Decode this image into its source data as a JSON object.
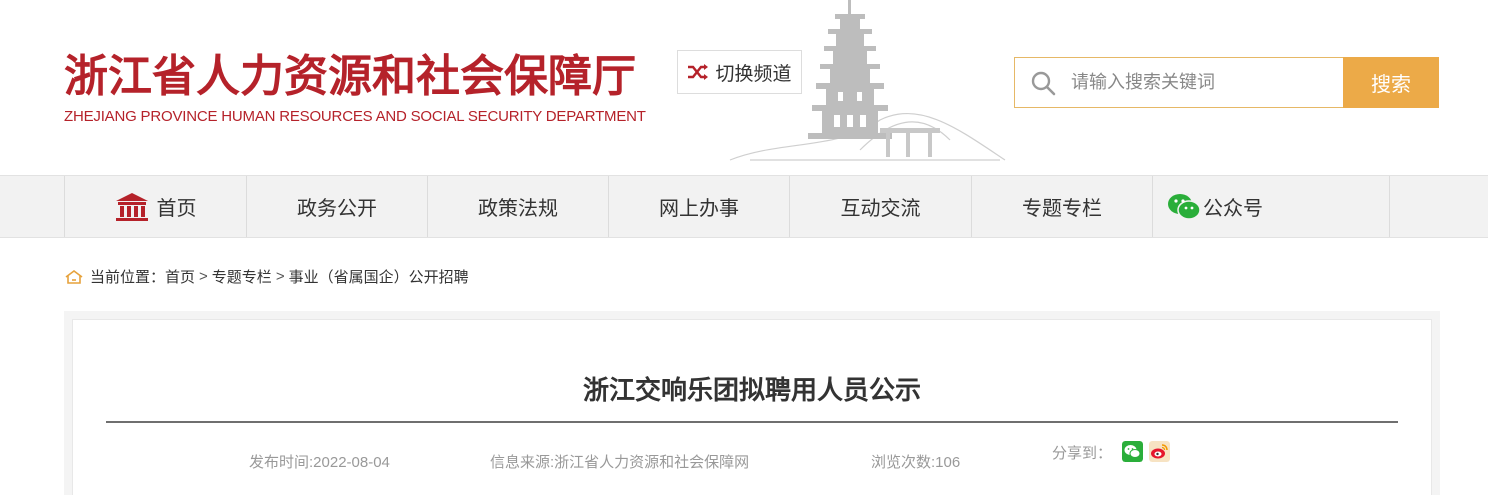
{
  "header": {
    "logo_cn": "浙江省人力资源和社会保障厅",
    "logo_en": "ZHEJIANG PROVINCE HUMAN RESOURCES AND SOCIAL SECURITY DEPARTMENT",
    "switch_label": "切换频道",
    "search_placeholder": "请输入搜索关键词",
    "search_button": "搜索"
  },
  "nav": {
    "items": [
      {
        "label": "首页",
        "icon": "building-icon"
      },
      {
        "label": "政务公开"
      },
      {
        "label": "政策法规"
      },
      {
        "label": "网上办事"
      },
      {
        "label": "互动交流"
      },
      {
        "label": "专题专栏"
      },
      {
        "label": "公众号",
        "icon": "wechat-icon"
      }
    ]
  },
  "breadcrumb": {
    "prefix": "当前位置：",
    "items": [
      "首页",
      "专题专栏",
      "事业（省属国企）公开招聘"
    ],
    "separator": ">"
  },
  "article": {
    "title": "浙江交响乐团拟聘用人员公示",
    "publish_time": "发布时间:2022-08-04",
    "source": "信息来源:浙江省人力资源和社会保障网",
    "views": "浏览次数:106",
    "share_label": "分享到："
  },
  "colors": {
    "brand_red": "#b5222a",
    "search_orange": "#ecaa48",
    "wechat_green": "#2aae3a",
    "weibo_red": "#e6162d"
  }
}
